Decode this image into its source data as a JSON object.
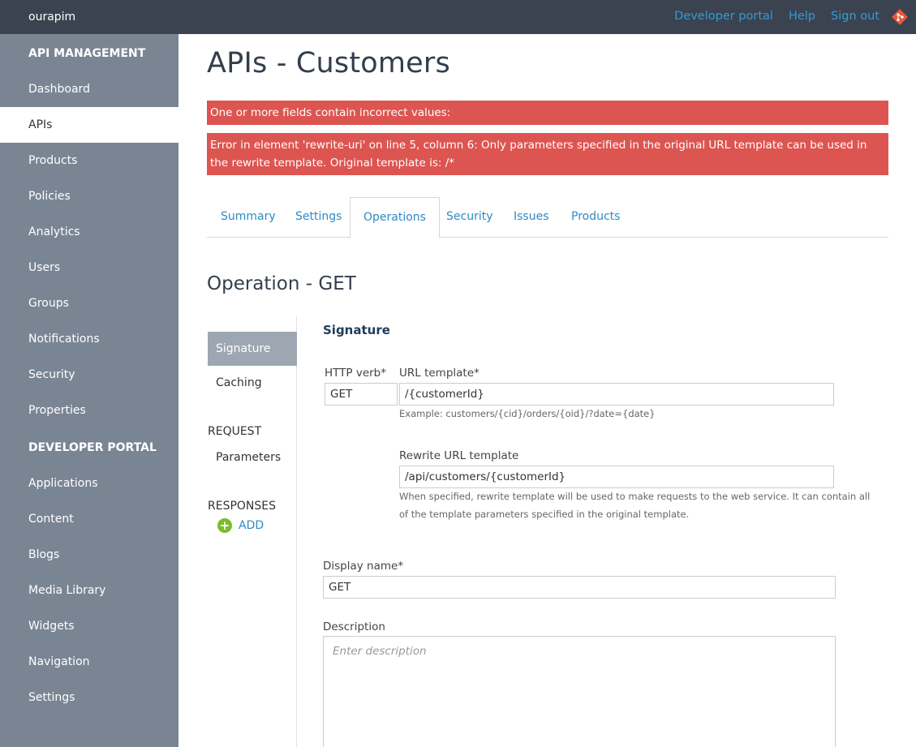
{
  "topbar": {
    "brand": "ourapim",
    "links": [
      "Developer portal",
      "Help",
      "Sign out"
    ]
  },
  "sidebar": {
    "items": [
      {
        "label": "API MANAGEMENT",
        "type": "section"
      },
      {
        "label": "Dashboard"
      },
      {
        "label": "APIs",
        "active": true
      },
      {
        "label": "Products"
      },
      {
        "label": "Policies"
      },
      {
        "label": "Analytics"
      },
      {
        "label": "Users"
      },
      {
        "label": "Groups"
      },
      {
        "label": "Notifications"
      },
      {
        "label": "Security"
      },
      {
        "label": "Properties"
      },
      {
        "label": "DEVELOPER PORTAL",
        "type": "section"
      },
      {
        "label": "Applications"
      },
      {
        "label": "Content"
      },
      {
        "label": "Blogs"
      },
      {
        "label": "Media Library"
      },
      {
        "label": "Widgets"
      },
      {
        "label": "Navigation"
      },
      {
        "label": "Settings"
      }
    ]
  },
  "main": {
    "title": "APIs - Customers",
    "errors": [
      "One or more fields contain incorrect values:",
      "Error in element 'rewrite-uri' on line 5, column 6: Only parameters specified in the original URL template can be used in the rewrite template. Original template is: /*"
    ],
    "tabs": [
      "Summary",
      "Settings",
      "Operations",
      "Security",
      "Issues",
      "Products"
    ],
    "active_tab": "Operations",
    "operation_title": "Operation - GET"
  },
  "subnav": {
    "signature": "Signature",
    "caching": "Caching",
    "request_heading": "REQUEST",
    "parameters": "Parameters",
    "responses_heading": "RESPONSES",
    "add_label": "ADD"
  },
  "signature": {
    "title": "Signature",
    "http_verb_label": "HTTP verb*",
    "http_verb_value": "GET",
    "url_template_label": "URL template*",
    "url_template_value": "/{customerId}",
    "url_template_hint": "Example: customers/{cid}/orders/{oid}/?date={date}",
    "rewrite_label": "Rewrite URL template",
    "rewrite_value": "/api/customers/{customerId}",
    "rewrite_hint_1": "When specified, rewrite template will be used to make requests to the web service. It can contain all",
    "rewrite_hint_2": "of the template parameters specified in the original template.",
    "display_name_label": "Display name*",
    "display_name_value": "GET",
    "description_label": "Description",
    "description_placeholder": "Enter description"
  },
  "colors": {
    "topbar": "#3b4350",
    "sidebar": "#7a8594",
    "link": "#2e9cd8",
    "error": "#dd5550",
    "add_icon": "#7cbb2b"
  }
}
